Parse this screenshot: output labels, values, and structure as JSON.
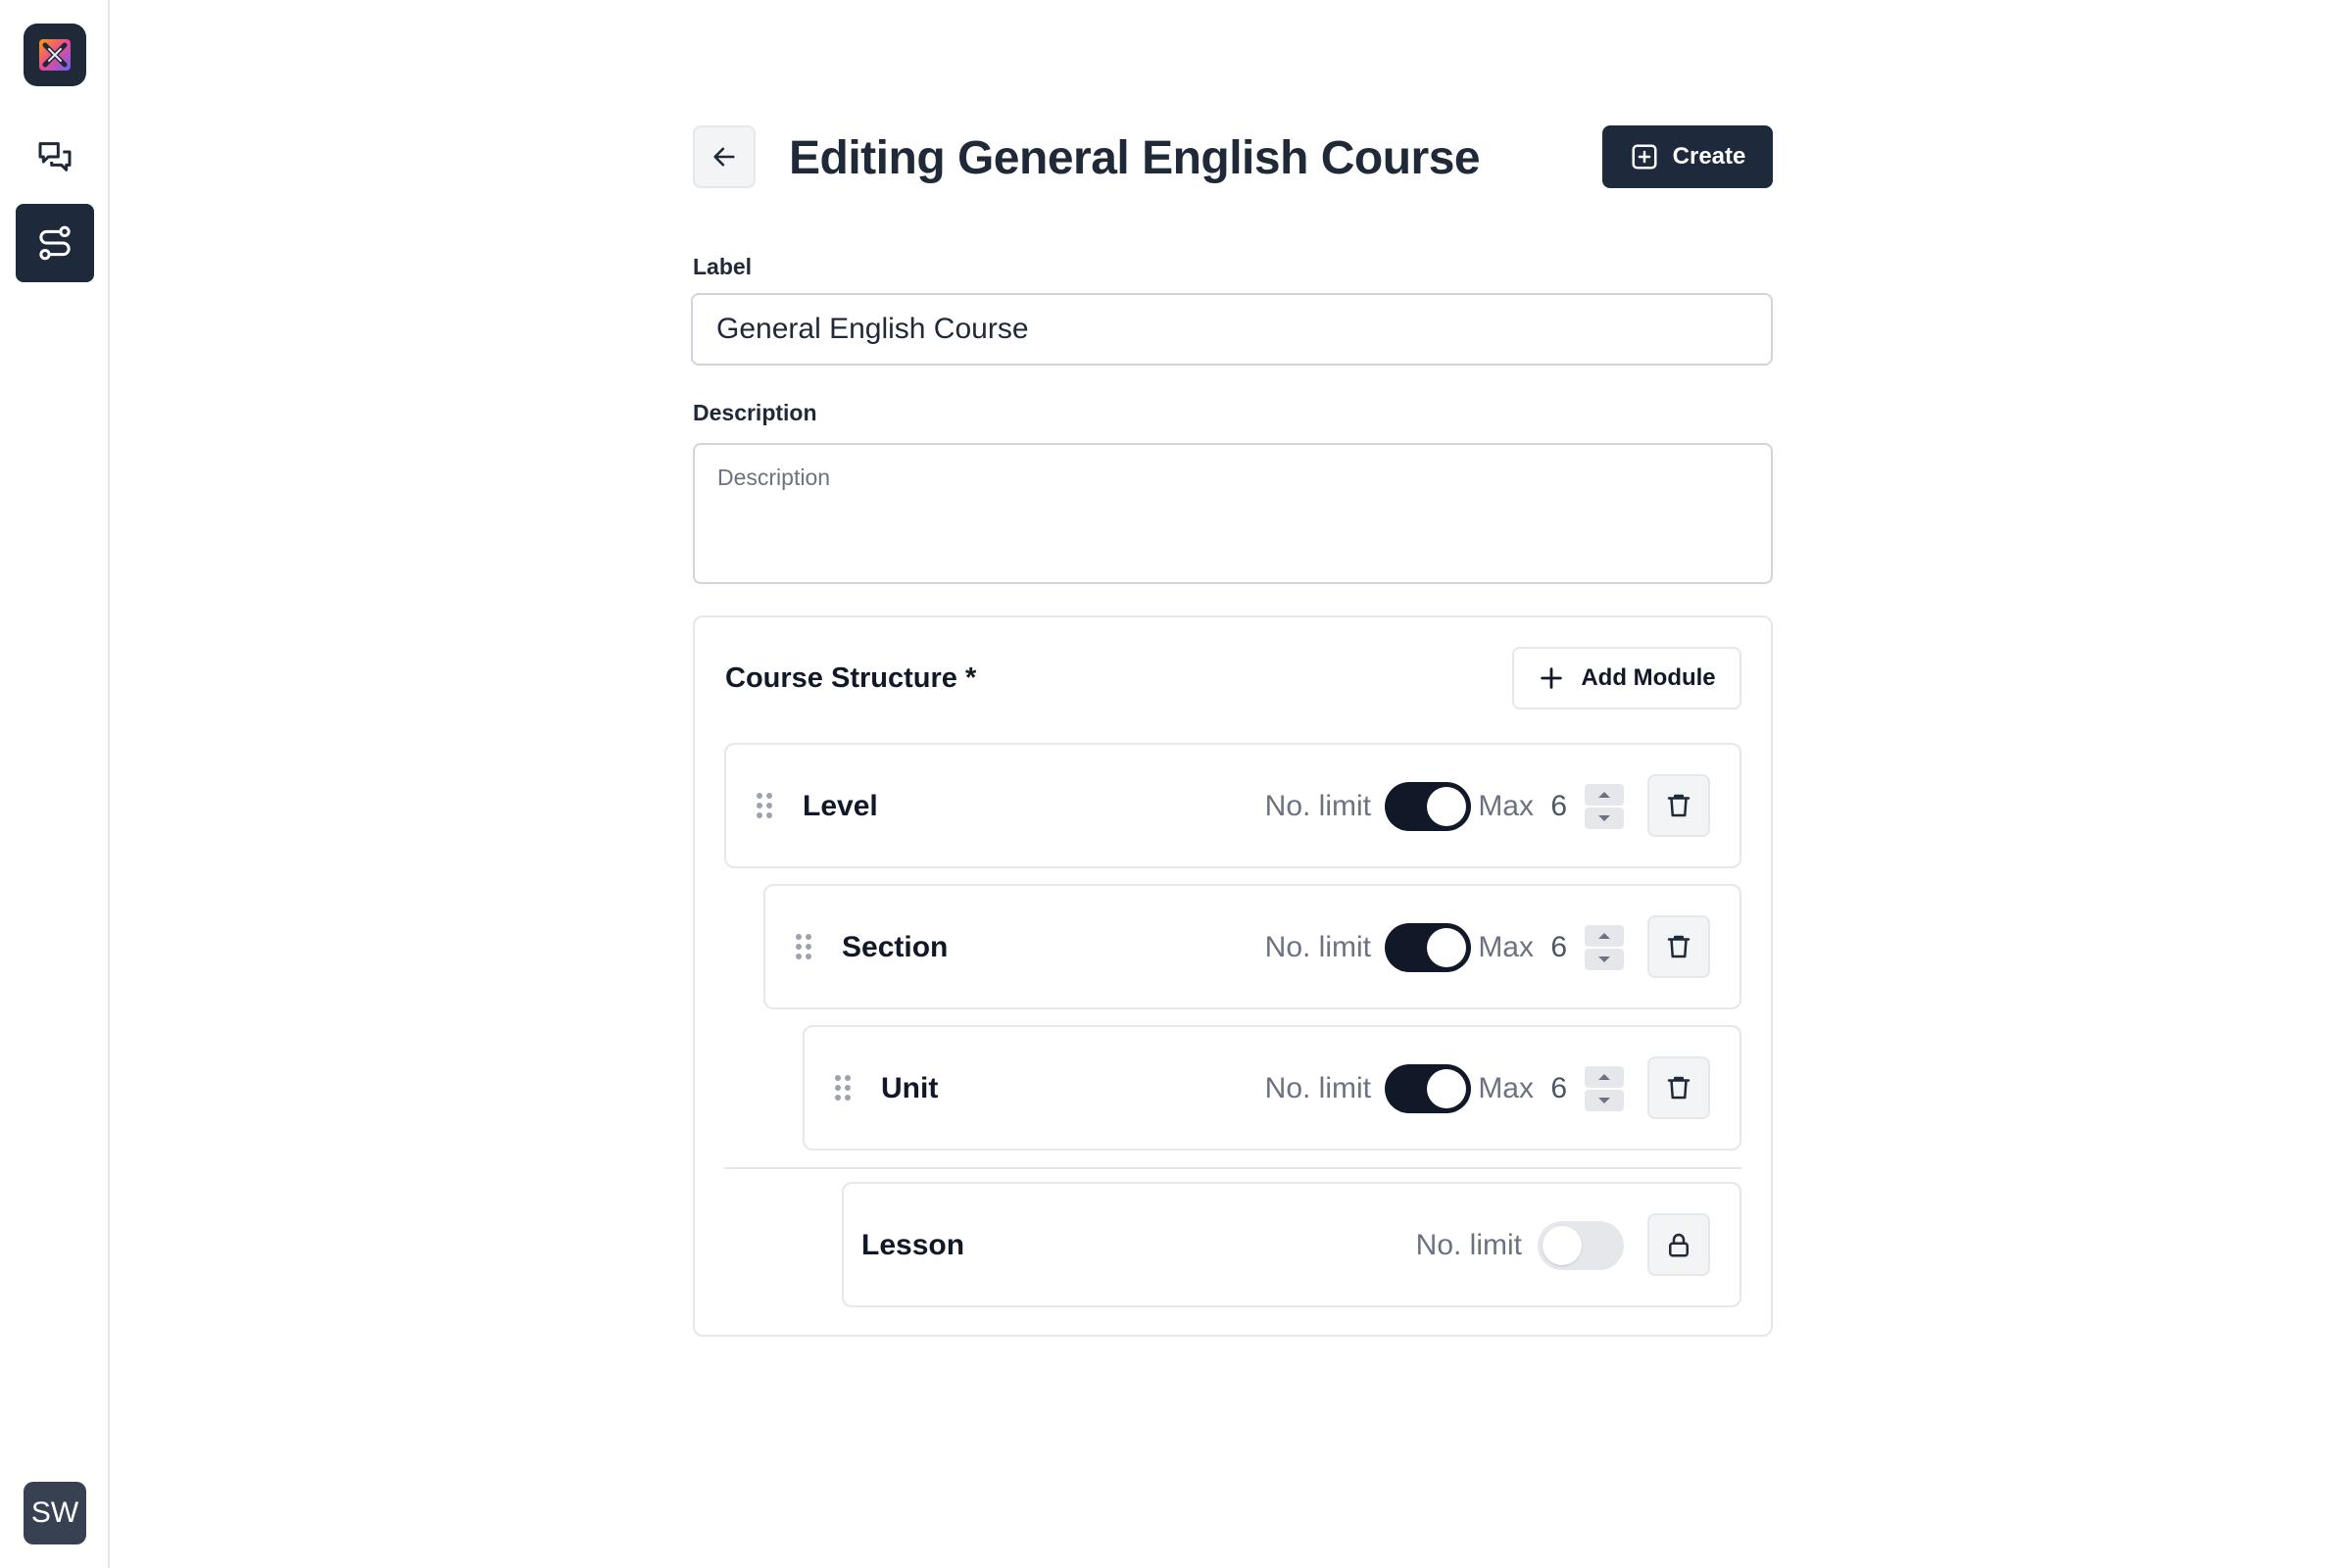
{
  "sidebar": {
    "logo": "app-logo",
    "nav": [
      {
        "name": "chat",
        "icon": "chat-bubbles-icon",
        "active": false
      },
      {
        "name": "workflows",
        "icon": "route-icon",
        "active": true
      }
    ],
    "avatar_initials": "SW"
  },
  "header": {
    "title": "Editing General English Course",
    "create_label": "Create"
  },
  "form": {
    "label_title": "Label",
    "label_value": "General English Course",
    "description_title": "Description",
    "description_placeholder": "Description"
  },
  "structure": {
    "title": "Course Structure *",
    "add_module_label": "Add Module",
    "modules": [
      {
        "name": "Level",
        "no_limit_label": "No. limit",
        "limited": true,
        "max_label": "Max",
        "max_value": "6"
      },
      {
        "name": "Section",
        "no_limit_label": "No. limit",
        "limited": true,
        "max_label": "Max",
        "max_value": "6"
      },
      {
        "name": "Unit",
        "no_limit_label": "No. limit",
        "limited": true,
        "max_label": "Max",
        "max_value": "6"
      }
    ],
    "final": {
      "name": "Lesson",
      "no_limit_label": "No. limit",
      "limited": false,
      "locked": true
    }
  },
  "colors": {
    "primary": "#1e293b",
    "border": "#e5e7eb",
    "muted_text": "#6b7280"
  }
}
